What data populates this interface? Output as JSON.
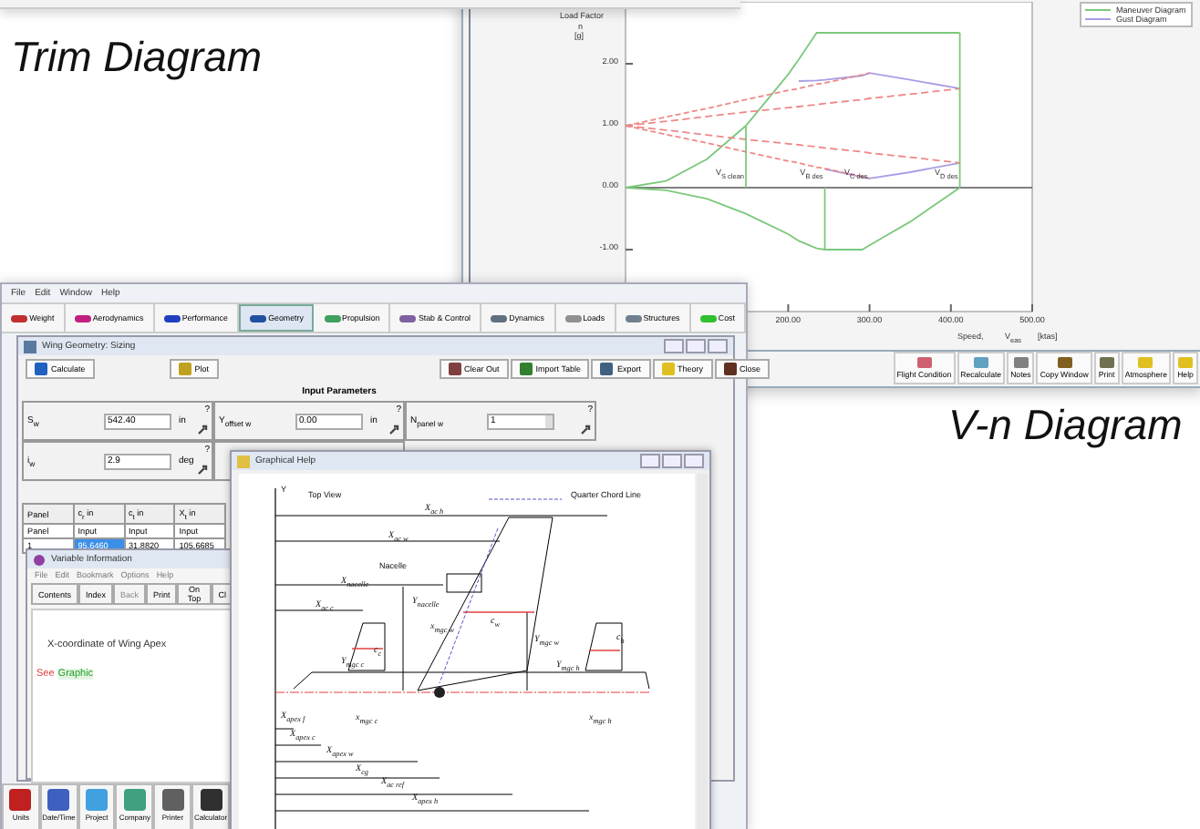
{
  "trim_caption": "Trim Diagram",
  "vn_caption": "V-n Diagram",
  "vn_window": {
    "y_axis_label": "Load Factor",
    "y_symbol": "n",
    "y_unit": "[g]",
    "x_axis_label": "Speed,",
    "x_symbol": "V$_{eas}$",
    "x_unit": "[ktas]",
    "chart_data": {
      "type": "line",
      "legend": "upper right",
      "ref_lines": [
        {
          "axis": "y",
          "value": 0
        }
      ],
      "x": [
        0,
        50,
        100,
        148,
        200,
        213,
        235,
        245,
        291,
        300,
        350,
        411
      ],
      "xlim": [
        0,
        500
      ],
      "ylim": [
        -2,
        3
      ],
      "xticks": [
        {
          "value": 200,
          "label": "200.00"
        },
        {
          "value": 300,
          "label": "300.00"
        },
        {
          "value": 400,
          "label": "400.00"
        },
        {
          "value": 500,
          "label": "500.00"
        }
      ],
      "yticks": [
        {
          "value": -1,
          "label": "-1.00"
        },
        {
          "value": 0,
          "label": "0.00"
        },
        {
          "value": 1,
          "label": "1.00"
        },
        {
          "value": 2,
          "label": "2.00"
        }
      ],
      "series": [
        {
          "name": "Maneuver Diagram",
          "color": "#7cc87c",
          "values": [
            0,
            0.11,
            0.46,
            1.0,
            1.83,
            2.07,
            2.5,
            2.5,
            2.5,
            2.5,
            2.5,
            2.5
          ]
        },
        {
          "color": "#7cc87c",
          "values": [
            0,
            -0.04,
            -0.18,
            -0.42,
            -0.75,
            -0.86,
            -0.98,
            -1,
            -1,
            -0.93,
            -0.55,
            0
          ]
        },
        {
          "name": "Gust Diagram",
          "color": "#a89ee6",
          "values": [
            null,
            null,
            null,
            null,
            null,
            1.72,
            1.73,
            1.74,
            1.81,
            1.85,
            1.74,
            1.6
          ]
        },
        {
          "color": "#a89ee6",
          "values": [
            null,
            null,
            null,
            null,
            null,
            null,
            null,
            0.3,
            0.17,
            0.15,
            0.25,
            0.4
          ]
        },
        {
          "color": "#ee8888",
          "line_style": "dashed",
          "values": [
            1,
            1.14,
            1.28,
            1.42,
            1.57,
            1.6,
            1.67,
            1.69,
            1.82,
            1.85,
            null,
            null
          ]
        },
        {
          "color": "#ee8888",
          "line_style": "dashed",
          "values": [
            1,
            1.07,
            1.15,
            1.22,
            1.29,
            1.31,
            1.34,
            1.36,
            1.42,
            1.44,
            1.51,
            1.6
          ]
        },
        {
          "color": "#ee8888",
          "line_style": "dashed",
          "values": [
            1,
            0.86,
            0.72,
            0.58,
            0.43,
            0.4,
            0.33,
            0.31,
            0.18,
            0.15,
            null,
            null
          ]
        },
        {
          "color": "#ee8888",
          "line_style": "dashed",
          "values": [
            1,
            0.93,
            0.85,
            0.78,
            0.71,
            0.69,
            0.66,
            0.64,
            0.58,
            0.56,
            0.49,
            0.4
          ]
        }
      ],
      "annotations": [
        {
          "x": 148,
          "y": 0,
          "text": "V$_{S clean}$"
        },
        {
          "x": 245,
          "y": 0,
          "text": "V$_{B des}$"
        },
        {
          "x": 300,
          "y": 0,
          "text": "V$_{C des}$"
        },
        {
          "x": 411,
          "y": 0,
          "text": "V$_{D des}$"
        }
      ]
    },
    "toolbar": [
      "Flight Condition",
      "Recalculate",
      "Notes",
      "Copy Window",
      "Print",
      "Atmosphere",
      "Help"
    ]
  },
  "main_window": {
    "menu": [
      "File",
      "Edit",
      "Window",
      "Help"
    ],
    "modules": [
      {
        "label": "Weight",
        "selected": false
      },
      {
        "label": "Aerodynamics",
        "selected": false
      },
      {
        "label": "Performance",
        "selected": false
      },
      {
        "label": "Geometry",
        "selected": true
      },
      {
        "label": "Propulsion",
        "selected": false
      },
      {
        "label": "Stab & Control",
        "selected": false
      },
      {
        "label": "Dynamics",
        "selected": false
      },
      {
        "label": "Loads",
        "selected": false
      },
      {
        "label": "Structures",
        "selected": false
      },
      {
        "label": "Cost",
        "selected": false
      }
    ],
    "bottom_bar": [
      "Units",
      "Date/Time",
      "Project",
      "Company",
      "Printer",
      "Calculator"
    ]
  },
  "wing_window": {
    "title": "Wing Geometry: Sizing",
    "buttons": [
      "Calculate",
      "Plot",
      "Clear Out",
      "Import Table",
      "Export",
      "Theory",
      "Close"
    ],
    "section_title": "Input Parameters",
    "inputs": [
      {
        "label": "S$_{w}$",
        "value": "542.40",
        "unit": "in",
        "kind": "text"
      },
      {
        "label": "Y$_{offset w}$",
        "value": "0.00",
        "unit": "in",
        "kind": "text"
      },
      {
        "label": "N$_{panel w}$",
        "value": "1",
        "kind": "spinner"
      },
      {
        "label": "i$_{w}$",
        "value": "2.9",
        "unit": "deg",
        "kind": "text"
      }
    ],
    "help_mark": "?",
    "table": {
      "columns": [
        "Panel",
        "c$_{r}$  in",
        "c$_{t}$  in",
        "X$_{t}$  in"
      ],
      "rows": [
        {
          "cells": [
            {
              "text": "Panel",
              "selected": false
            },
            {
              "text": "Input",
              "selected": false
            },
            {
              "text": "Input",
              "selected": false
            },
            {
              "text": "Input",
              "selected": false
            }
          ]
        },
        {
          "cells": [
            {
              "text": "1",
              "selected": false
            },
            {
              "text": "95.6460",
              "selected": true
            },
            {
              "text": "31.8820",
              "selected": false
            },
            {
              "text": "105.6685",
              "selected": false
            }
          ]
        }
      ]
    }
  },
  "variable_window": {
    "title": "Variable Information",
    "menu": [
      "File",
      "Edit",
      "Bookmark",
      "Options",
      "Help"
    ],
    "buttons": [
      {
        "label": "Contents",
        "disabled": false
      },
      {
        "label": "Index",
        "disabled": false
      },
      {
        "label": "Back",
        "disabled": true
      },
      {
        "label": "Print",
        "disabled": false
      },
      {
        "label": "On Top",
        "disabled": false
      },
      {
        "label": "Cl",
        "disabled": false
      }
    ],
    "text": "X-coordinate of Wing Apex",
    "see": "See",
    "link": "Graphic"
  },
  "graphic_window": {
    "title": "Graphical Help",
    "axis": "Y",
    "view": "Top View",
    "legend": "Quarter Chord Line",
    "nacelle": "Nacelle",
    "labels": [
      "X$_{ac h}$",
      "X$_{ac w}$",
      "X$_{nacelle}$",
      "X$_{ac c}$",
      "Y$_{nacelle}$",
      "x$_{mgc w}$",
      "c$_{w}$",
      "Y$_{mgc w}$",
      "c$_{c}$",
      "Y$_{mgc c}$",
      "c$_{h}$",
      "Y$_{mgc h}$",
      "X$_{apex f}$",
      "x$_{mgc c}$",
      "x$_{mgc h}$",
      "X$_{apex c}$",
      "X$_{apex w}$",
      "X$_{cg}$",
      "X$_{ac ref}$",
      "X$_{apex h}$"
    ]
  }
}
